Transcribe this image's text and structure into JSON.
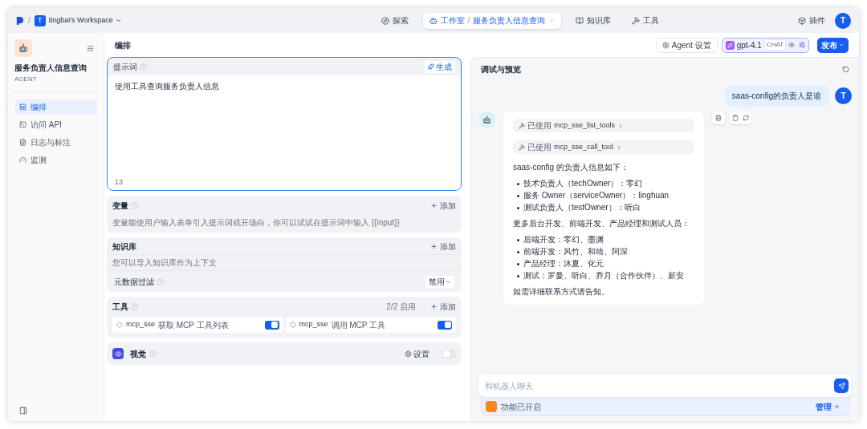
{
  "nav": {
    "separator": "/",
    "workspace_initial": "T",
    "workspace": "tingbai's Workspace",
    "tabs": [
      {
        "label": "探索",
        "selected": false
      },
      {
        "label": "工作室",
        "crumb_separator": "/",
        "crumb": "服务负责人信息查询",
        "selected": true
      },
      {
        "label": "知识库",
        "selected": false
      },
      {
        "label": "工具",
        "selected": false
      }
    ],
    "plugins": "插件",
    "avatar": "T"
  },
  "sidebar": {
    "app_name": "服务负责人信息查询",
    "app_type": "AGENT",
    "items": [
      {
        "label": "编排",
        "selected": true
      },
      {
        "label": "访问 API",
        "selected": false
      },
      {
        "label": "日志与标注",
        "selected": false
      },
      {
        "label": "监测",
        "selected": false
      }
    ]
  },
  "toolbar": {
    "title": "编排",
    "agent_settings": "Agent 设置",
    "model": "gpt-4.1",
    "model_mode": "CHAT",
    "publish": "发布"
  },
  "prompt": {
    "label": "提示词",
    "generate": "生成",
    "text": "使用工具查询服务负责人信息",
    "count": "13"
  },
  "variables": {
    "label": "变量",
    "add": "添加",
    "hint": "变量能使用户输入表单引入提示词或开场白，你可以试试在提示词中输入 {{input}}"
  },
  "knowledge": {
    "label": "知识库",
    "add": "添加",
    "hint": "您可以导入知识库作为上下文",
    "filter_label": "元数据过滤",
    "filter_value": "禁用"
  },
  "tools": {
    "label": "工具",
    "count": "2/2 启用",
    "add": "添加",
    "items": [
      {
        "name": "mcp_sse",
        "description": "获取 MCP 工具列表",
        "on": true
      },
      {
        "name": "mcp_sse",
        "description": "调用 MCP 工具",
        "on": true
      }
    ]
  },
  "vision": {
    "label": "视觉",
    "settings": "设置",
    "on": false
  },
  "preview": {
    "title": "调试与预览",
    "user_avatar": "T",
    "user_message": "saas-config的负责人是谁",
    "tool_calls": [
      {
        "prefix": "已使用",
        "name": "mcp_sse_list_tools"
      },
      {
        "prefix": "已使用",
        "name": "mcp_sse_call_tool"
      }
    ],
    "answer": [
      {
        "kind": "para",
        "text": "saas-config 的负责人信息如下："
      },
      {
        "kind": "list",
        "items": [
          "技术负责人（techOwner）：零幻",
          "服务 Owner（serviceOwner）：linghuan",
          "测试负责人（testOwner）：听白"
        ]
      },
      {
        "kind": "para",
        "text": "更多后台开发、前端开发、产品经理和测试人员："
      },
      {
        "kind": "list",
        "items": [
          "后端开发：零幻、墨渊",
          "前端开发：风竹、和靖、阿深",
          "产品经理：沐夏、化元",
          "测试：罗曼、听白、乔月（合作伙伴）、新安"
        ]
      },
      {
        "kind": "para",
        "text": "如需详细联系方式请告知。"
      }
    ],
    "input_placeholder": "和机器人聊天",
    "features": "功能已开启",
    "manage": "管理"
  }
}
